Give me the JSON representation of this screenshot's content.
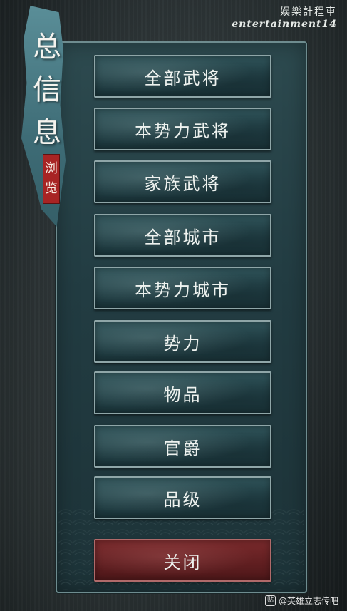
{
  "watermark": {
    "line1": "娱樂計程車",
    "line2": "entertainment14"
  },
  "banner": {
    "title_chars": [
      "总",
      "信",
      "息"
    ],
    "seal_chars": [
      "浏",
      "览"
    ]
  },
  "menu": {
    "items": [
      {
        "label": "全部武将"
      },
      {
        "label": "本势力武将"
      },
      {
        "label": "家族武将"
      },
      {
        "label": "全部城市"
      },
      {
        "label": "本势力城市"
      },
      {
        "label": "势力"
      },
      {
        "label": "物品"
      },
      {
        "label": "官爵"
      },
      {
        "label": "品级"
      }
    ],
    "close_label": "关闭"
  },
  "footer": {
    "icon_text": "贴",
    "credit": "@英雄立志传吧"
  },
  "colors": {
    "button_fill": "#203e44",
    "close_fill": "#5f1e20",
    "seal_red": "#a82424",
    "banner_teal": "#4a7d87"
  }
}
